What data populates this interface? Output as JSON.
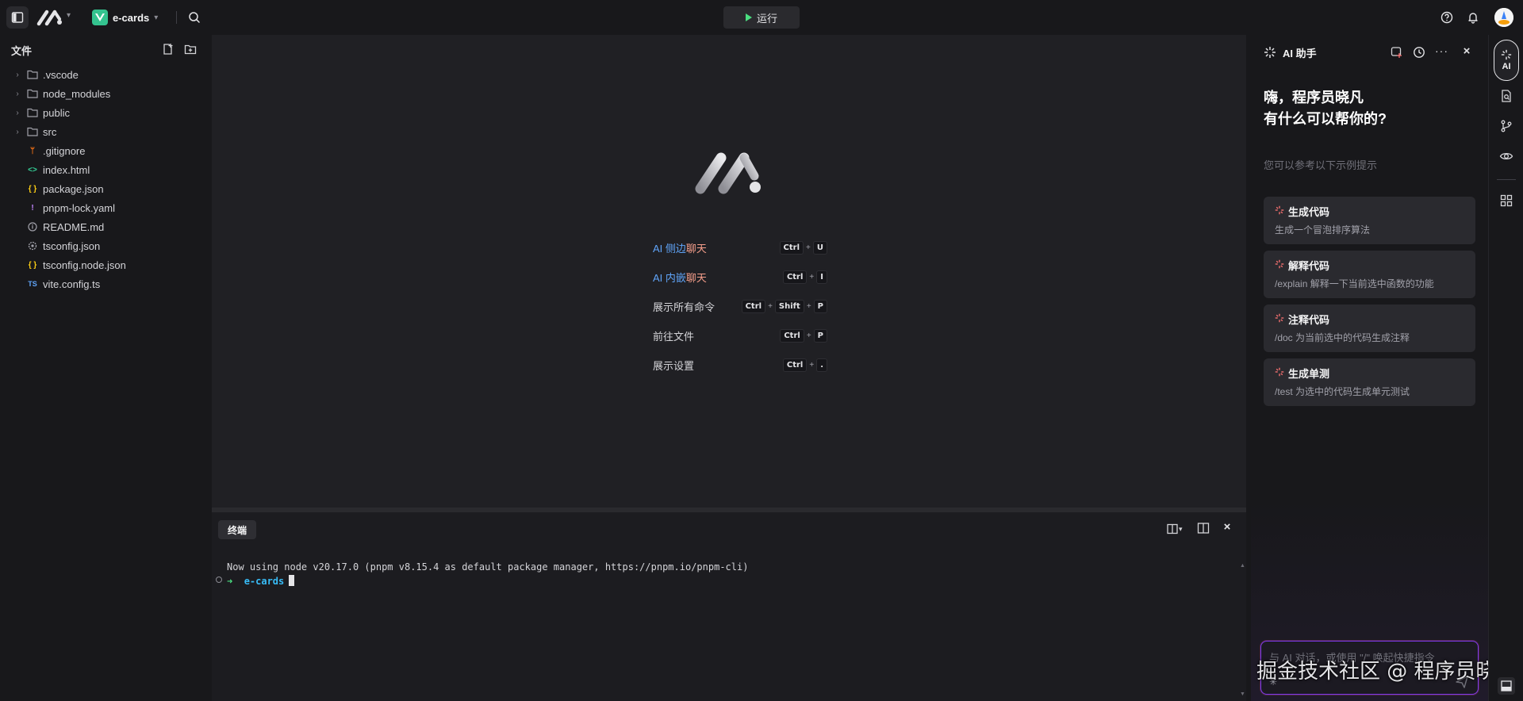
{
  "topbar": {
    "project_name": "e-cards",
    "run_label": "运行"
  },
  "explorer": {
    "title": "文件",
    "items": [
      {
        "name": ".vscode",
        "type": "folder"
      },
      {
        "name": "node_modules",
        "type": "folder"
      },
      {
        "name": "public",
        "type": "folder"
      },
      {
        "name": "src",
        "type": "folder"
      },
      {
        "name": ".gitignore",
        "type": "git"
      },
      {
        "name": "index.html",
        "type": "html"
      },
      {
        "name": "package.json",
        "type": "json"
      },
      {
        "name": "pnpm-lock.yaml",
        "type": "yaml"
      },
      {
        "name": "README.md",
        "type": "md"
      },
      {
        "name": "tsconfig.json",
        "type": "tsconfig"
      },
      {
        "name": "tsconfig.node.json",
        "type": "json"
      },
      {
        "name": "vite.config.ts",
        "type": "ts"
      }
    ]
  },
  "welcome": {
    "shortcuts": [
      {
        "prefix": "AI ",
        "label": "侧边",
        "highlight": "聊天",
        "keys": [
          "Ctrl",
          "U"
        ]
      },
      {
        "prefix": "AI ",
        "label": "内嵌",
        "highlight": "聊天",
        "keys": [
          "Ctrl",
          "I"
        ]
      },
      {
        "prefix": "",
        "label": "展示所有命令",
        "highlight": "",
        "keys": [
          "Ctrl",
          "Shift",
          "P"
        ]
      },
      {
        "prefix": "",
        "label": "前往文件",
        "highlight": "",
        "keys": [
          "Ctrl",
          "P"
        ]
      },
      {
        "prefix": "",
        "label": "展示设置",
        "highlight": "",
        "keys": [
          "Ctrl",
          "."
        ]
      }
    ]
  },
  "terminal": {
    "tab_label": "终端",
    "line1": "Now using node v20.17.0 (pnpm v8.15.4 as default package manager, https://pnpm.io/pnpm-cli)",
    "prompt_arrow": "➜",
    "prompt_dir": "e-cards"
  },
  "ai_panel": {
    "title": "AI 助手",
    "greeting_line1": "嗨，程序员晓凡",
    "greeting_line2": "有什么可以帮你的?",
    "hint": "您可以参考以下示例提示",
    "cards": [
      {
        "title": "生成代码",
        "desc": "生成一个冒泡排序算法"
      },
      {
        "title": "解释代码",
        "desc": "/explain 解释一下当前选中函数的功能"
      },
      {
        "title": "注释代码",
        "desc": "/doc 为当前选中的代码生成注释"
      },
      {
        "title": "生成单测",
        "desc": "/test 为选中的代码生成单元测试"
      }
    ],
    "input_placeholder": "与 AI 对话，或使用 \"/\" 唤起快捷指令"
  },
  "activity": {
    "ai_label": "AI"
  },
  "watermark": "掘金技术社区 @ 程序员晓凡",
  "colors": {
    "accent_green": "#4ade80",
    "accent_blue": "#60a5fa",
    "accent_pink": "#f59e8b",
    "input_border": "#7c3aed"
  }
}
